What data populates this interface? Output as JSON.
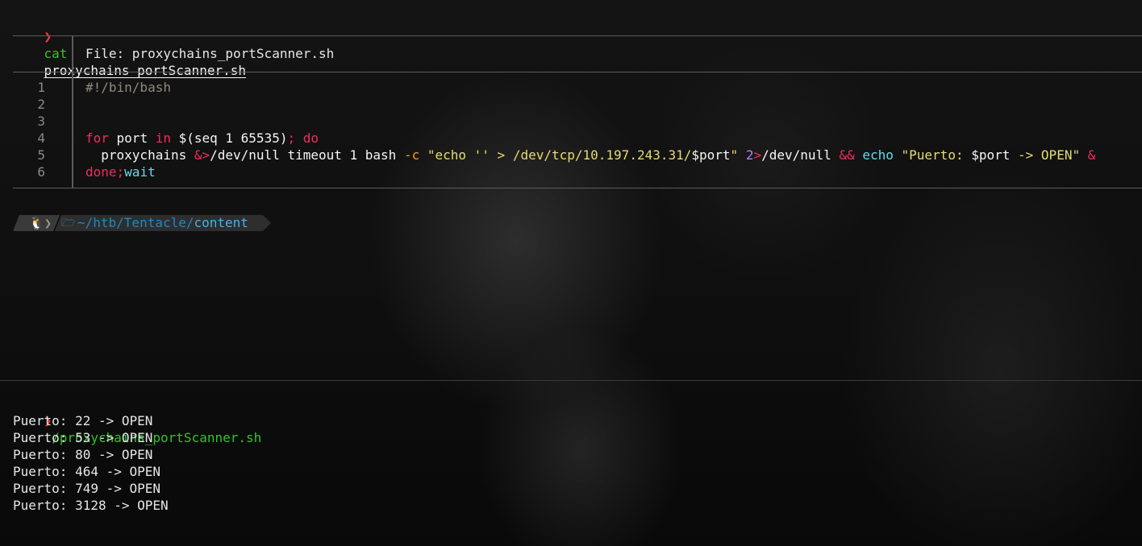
{
  "command1": {
    "prompt_symbol": "❯",
    "command": "cat",
    "argument": "proxychains_portScanner.sh"
  },
  "file_header": {
    "label": "File: proxychains_portScanner.sh"
  },
  "code": {
    "line_numbers": [
      "1",
      "2",
      "3",
      "4",
      "5",
      "6"
    ],
    "line1": "#!/bin/bash",
    "line4": {
      "kw_for": "for",
      "port": " port ",
      "kw_in": "in",
      "seq": " $(seq 1 65535)",
      "semi_do": "; do"
    },
    "line5": {
      "indent": "  proxychains ",
      "redir1": "&>",
      "devnull1": "/dev/null timeout 1 bash ",
      "flag": "-c",
      "space": " ",
      "str1": "\"echo '' > /dev/tcp/10.197.243.31/",
      "var": "$port",
      "str1_end": "\"",
      "space2": " ",
      "fd": "2",
      "redir2": ">",
      "devnull2": "/dev/null ",
      "and": "&&",
      "space3": " ",
      "echo": "echo",
      "space4": " ",
      "str2a": "\"Puerto: ",
      "var2": "$port",
      "str2b": " -> OPEN\"",
      "space5": " ",
      "bg": "&"
    },
    "line6": {
      "done": "done;",
      "wait": "wait"
    }
  },
  "powerline": {
    "tux_icon": "🐧",
    "chevron": "❯",
    "folder_icon": "🗁",
    "path_prefix": "~/htb/Tentacle/",
    "path_cwd": "content"
  },
  "command2": {
    "prompt_symbol": "❯",
    "command": "./proxychains_portScanner.sh"
  },
  "output": [
    "Puerto: 22 -> OPEN",
    "Puerto: 53 -> OPEN",
    "Puerto: 80 -> OPEN",
    "Puerto: 464 -> OPEN",
    "Puerto: 749 -> OPEN",
    "Puerto: 3128 -> OPEN"
  ],
  "colors": {
    "prompt": "#ff3b3b",
    "command": "#2ec52e",
    "keyword": "#f22c5f",
    "string": "#e6db74",
    "builtin": "#66d9ef",
    "path_blue": "#1e88c8"
  }
}
